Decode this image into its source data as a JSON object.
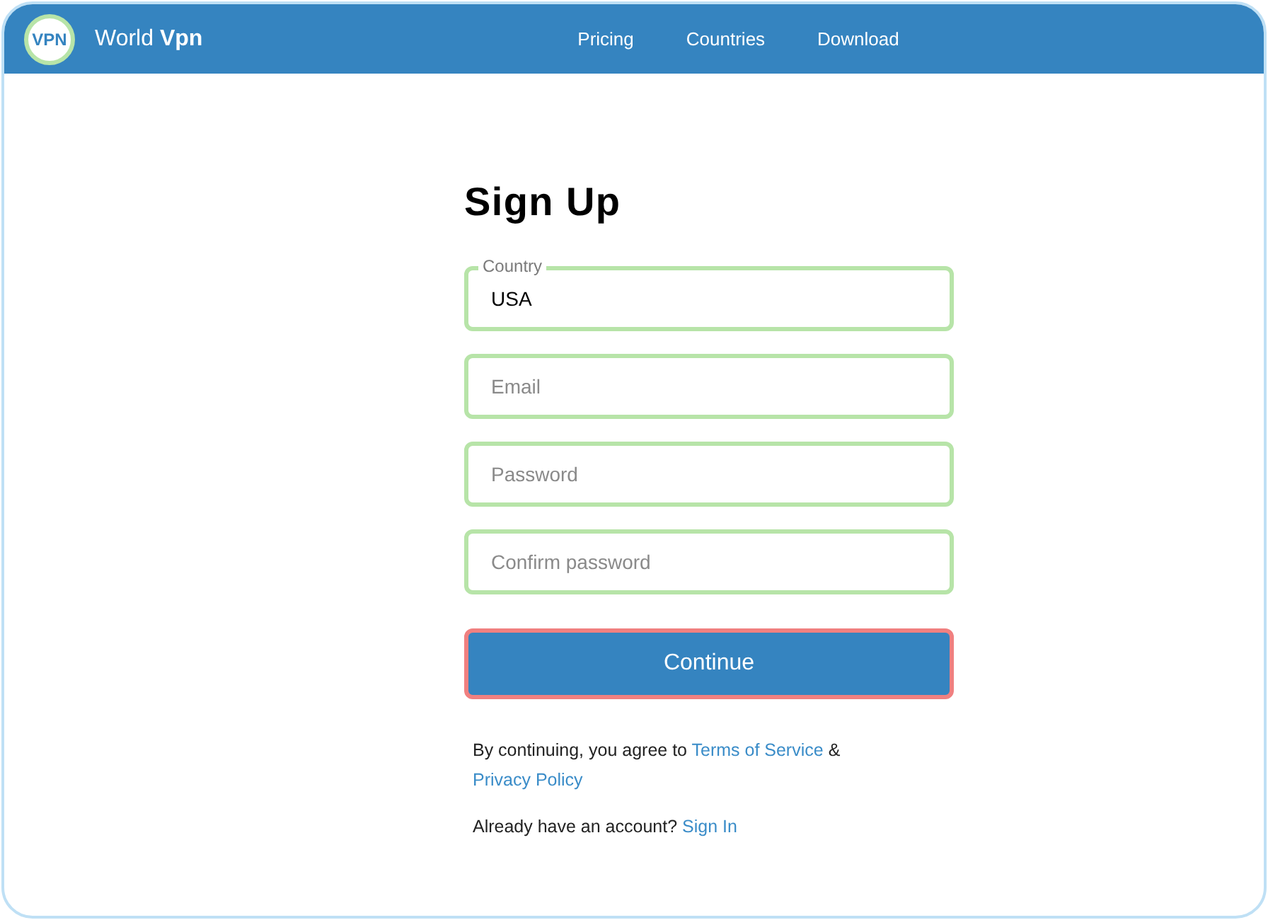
{
  "header": {
    "logo": "VPN",
    "brand": "World **Vpn**",
    "nav": [
      {
        "label": "Pricing"
      },
      {
        "label": "Countries"
      },
      {
        "label": "Download"
      }
    ]
  },
  "form": {
    "title": "Sign Up",
    "fields": [
      {
        "label": "Country",
        "value": "USA"
      },
      {
        "placeholder": "Email"
      },
      {
        "placeholder": "Password"
      },
      {
        "placeholder": "Confirm password"
      }
    ],
    "button": "Continue",
    "agreement": {
      "before": "By continuing, you agree to",
      "terms_link": "Terms of Service",
      "between": "&",
      "privacy_link": "Privacy Policy"
    },
    "signin": {
      "text": "Already have an account?",
      "link": "Sign In"
    }
  }
}
